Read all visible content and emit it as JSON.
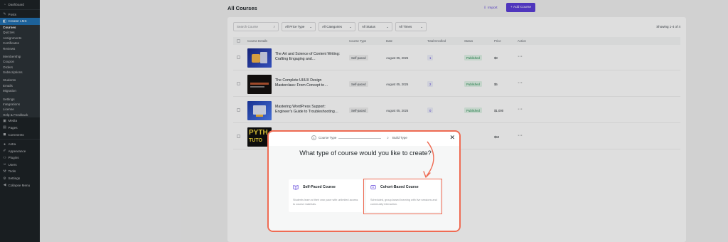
{
  "sidebar": {
    "items": [
      {
        "label": "Dashboard",
        "icon": "dashboard-icon"
      },
      {
        "label": "Posts",
        "icon": "pin-icon"
      },
      {
        "label": "Creator LMS",
        "icon": "lms-icon"
      }
    ],
    "lms_sub": [
      "Courses",
      "Quizzes",
      "Assignments",
      "Certificates",
      "Reviews",
      "Membership",
      "Coupon",
      "Orders",
      "Subscriptions",
      "Students",
      "Emails",
      "Migration",
      "Settings",
      "Integrations",
      "License",
      "Help & Feedback"
    ],
    "tail": [
      {
        "label": "Media",
        "icon": "media-icon"
      },
      {
        "label": "Pages",
        "icon": "pages-icon"
      },
      {
        "label": "Comments",
        "icon": "comments-icon"
      },
      {
        "label": "Astra",
        "icon": "astra-icon"
      },
      {
        "label": "Appearance",
        "icon": "brush-icon"
      },
      {
        "label": "Plugins",
        "icon": "plugin-icon"
      },
      {
        "label": "Users",
        "icon": "users-icon"
      },
      {
        "label": "Tools",
        "icon": "wrench-icon"
      },
      {
        "label": "Settings",
        "icon": "gear-icon"
      },
      {
        "label": "Collapse Menu",
        "icon": "collapse-icon"
      }
    ]
  },
  "header": {
    "title": "All Courses",
    "import_label": "Import",
    "add_label": "+ Add Course"
  },
  "filters": {
    "search_placeholder": "Search Course",
    "price": "All Price Type",
    "categories": "All Categories",
    "status": "All Status",
    "times": "All Times",
    "showing": "Showing 1-4 of 4"
  },
  "table": {
    "columns": [
      "Course Details",
      "Course Type",
      "Date",
      "Total Enrolled",
      "Status",
      "Price",
      "Action"
    ],
    "rows": [
      {
        "title": "The Art and Science of Content Writing: Crafting Engaging and…",
        "type": "Self-paced",
        "date": "August 05, 2025",
        "enrolled": "1",
        "status": "Published",
        "price": "$8"
      },
      {
        "title": "The Complete UI/UX Design Masterclass: From Concept to…",
        "type": "Self-paced",
        "date": "August 05, 2025",
        "enrolled": "2",
        "status": "Published",
        "price": "$5"
      },
      {
        "title": "Mastering WordPress Support: Engineer's Guide to Troubleshooting…",
        "type": "Self-paced",
        "date": "August 05, 2025",
        "enrolled": "0",
        "status": "Published",
        "price": "$1,000"
      },
      {
        "title": "",
        "type": "",
        "date": "",
        "enrolled": "",
        "status": "",
        "price": "$50"
      }
    ],
    "row4_thumb_text_1": "PYTH",
    "row4_thumb_text_2": "TUTO"
  },
  "modal": {
    "step1_num": "1",
    "step1_label": "Course Type",
    "step2_num": "2",
    "step2_label": "Build Type",
    "question": "What type of course would you like to create?",
    "options": [
      {
        "title": "Self-Paced Course",
        "desc": "Students learn at their own pace with unlimited access to course materials.",
        "icon": "book-icon"
      },
      {
        "title": "Cohort-Based Course",
        "desc": "Scheduled, group-based learning with live sessions and community interaction.",
        "icon": "video-icon"
      }
    ]
  },
  "colors": {
    "accent": "#5b3fd9",
    "highlight": "#ef6b53",
    "sidebar_bg": "#1d2327",
    "sidebar_active": "#2271b1"
  }
}
